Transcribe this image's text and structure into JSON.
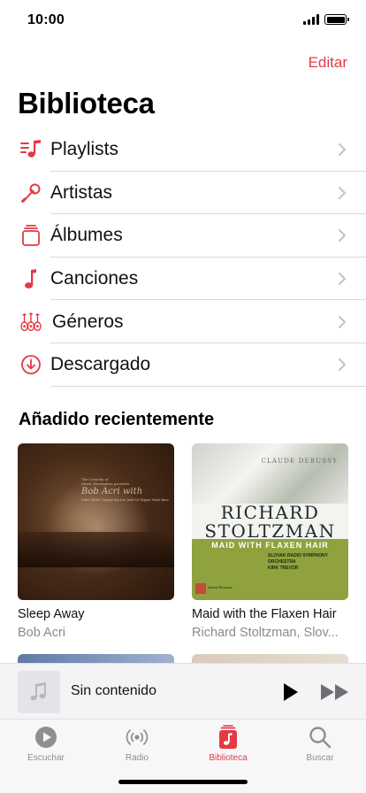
{
  "status_bar": {
    "time": "10:00"
  },
  "header": {
    "edit_label": "Editar",
    "title": "Biblioteca"
  },
  "menu": {
    "items": [
      {
        "label": "Playlists",
        "icon": "playlist-icon"
      },
      {
        "label": "Artistas",
        "icon": "microphone-icon"
      },
      {
        "label": "Álbumes",
        "icon": "album-stack-icon"
      },
      {
        "label": "Canciones",
        "icon": "music-note-icon"
      },
      {
        "label": "Géneros",
        "icon": "guitars-icon"
      },
      {
        "label": "Descargado",
        "icon": "download-icon"
      }
    ]
  },
  "recently_added": {
    "title": "Añadido recientemente",
    "albums": [
      {
        "title": "Sleep Away",
        "artist": "Bob Acri",
        "cover_lines": [
          "The Comedy of",
          "Music Excerption presents",
          "Bob Acri with",
          "Duke Gloire Cayuga Kip Lee Judd Lil Hipper Hank Bass"
        ]
      },
      {
        "title": "Maid with the Flaxen Hair",
        "artist": "Richard Stoltzman, Slov...",
        "cover": {
          "composer": "CLAUDE DEBUSSY",
          "line1": "RICHARD",
          "line2": "STOLTZMAN",
          "subtitle": "MAID WITH FLAXEN HAIR",
          "orchestra": "SLOVAK RADIO SYMPHONY ORCHESTRA",
          "conductor": "KIRK TREVOR",
          "label": "Naxos Records"
        }
      }
    ]
  },
  "mini_player": {
    "title": "Sin contenido"
  },
  "tab_bar": {
    "tabs": [
      {
        "label": "Escuchar",
        "icon": "play-circle-icon"
      },
      {
        "label": "Radio",
        "icon": "radio-icon"
      },
      {
        "label": "Biblioteca",
        "icon": "library-icon",
        "active": true
      },
      {
        "label": "Buscar",
        "icon": "search-icon"
      }
    ]
  },
  "colors": {
    "accent": "#e33a45",
    "secondary_text": "#8a8a8e",
    "divider": "#d9d9de"
  }
}
